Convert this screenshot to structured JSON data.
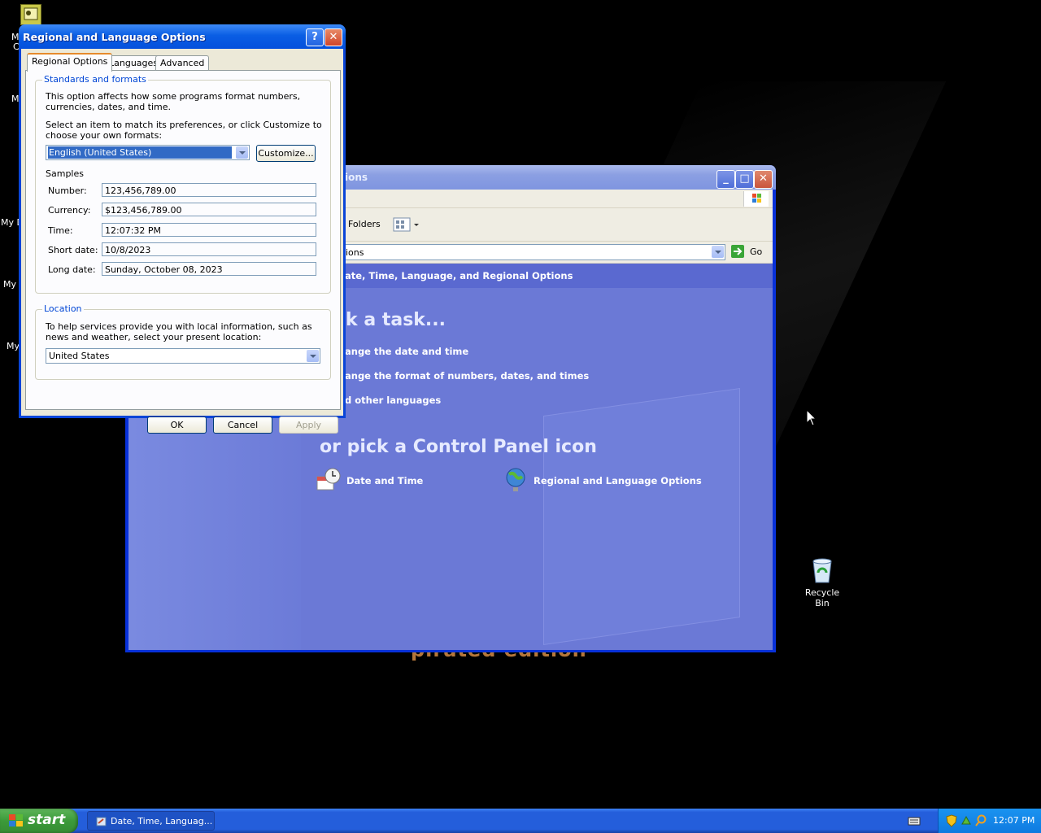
{
  "desktop": {
    "watermark": "pirated edition",
    "recycle_bin_label": "Recycle Bin",
    "left_partial_labels": [
      "M",
      "C",
      "M",
      "My D",
      "My",
      "My"
    ]
  },
  "explorer": {
    "title_partial": "ions",
    "toolbar": {
      "folders_label": "Folders"
    },
    "address": {
      "value_partial": "ions",
      "go_label": "Go"
    },
    "header": "ate, Time, Language, and Regional Options",
    "pick_task_heading": "ck a task...",
    "tasks": [
      "ange the date and time",
      "ange the format of numbers, dates, and times",
      "d other languages"
    ],
    "pick_icon_heading": "or pick a Control Panel icon",
    "icons": [
      {
        "label": "Date and Time",
        "icon": "clock-calendar-icon"
      },
      {
        "label": "Regional and Language Options",
        "icon": "globe-icon"
      }
    ]
  },
  "dialog": {
    "title": "Regional and Language Options",
    "help_button": "?",
    "close_button": "✕",
    "tabs": [
      "Regional Options",
      "Languages",
      "Advanced"
    ],
    "standards_group": {
      "label": "Standards and formats",
      "description": "This option affects how some programs format numbers, currencies, dates, and time.",
      "instruction": "Select an item to match its preferences, or click Customize to choose your own formats:",
      "selected_locale": "English (United States)",
      "customize_label": "Customize...",
      "samples_label": "Samples",
      "samples": [
        {
          "label": "Number:",
          "value": "123,456,789.00"
        },
        {
          "label": "Currency:",
          "value": "$123,456,789.00"
        },
        {
          "label": "Time:",
          "value": "12:07:32 PM"
        },
        {
          "label": "Short date:",
          "value": "10/8/2023"
        },
        {
          "label": "Long date:",
          "value": "Sunday, October 08, 2023"
        }
      ]
    },
    "location_group": {
      "label": "Location",
      "description": "To help services provide you with local information, such as news and weather, select your present location:",
      "selected_location": "United States"
    },
    "buttons": {
      "ok": "OK",
      "cancel": "Cancel",
      "apply": "Apply"
    }
  },
  "taskbar": {
    "start_label": "start",
    "task_item": "Date, Time, Languag...",
    "clock": "12:07 PM"
  },
  "colors": {
    "xp_blue": "#245edb",
    "start_green": "#3c9a3a",
    "cp_blue": "#6b79d6",
    "group_label_blue": "#0046d5"
  }
}
